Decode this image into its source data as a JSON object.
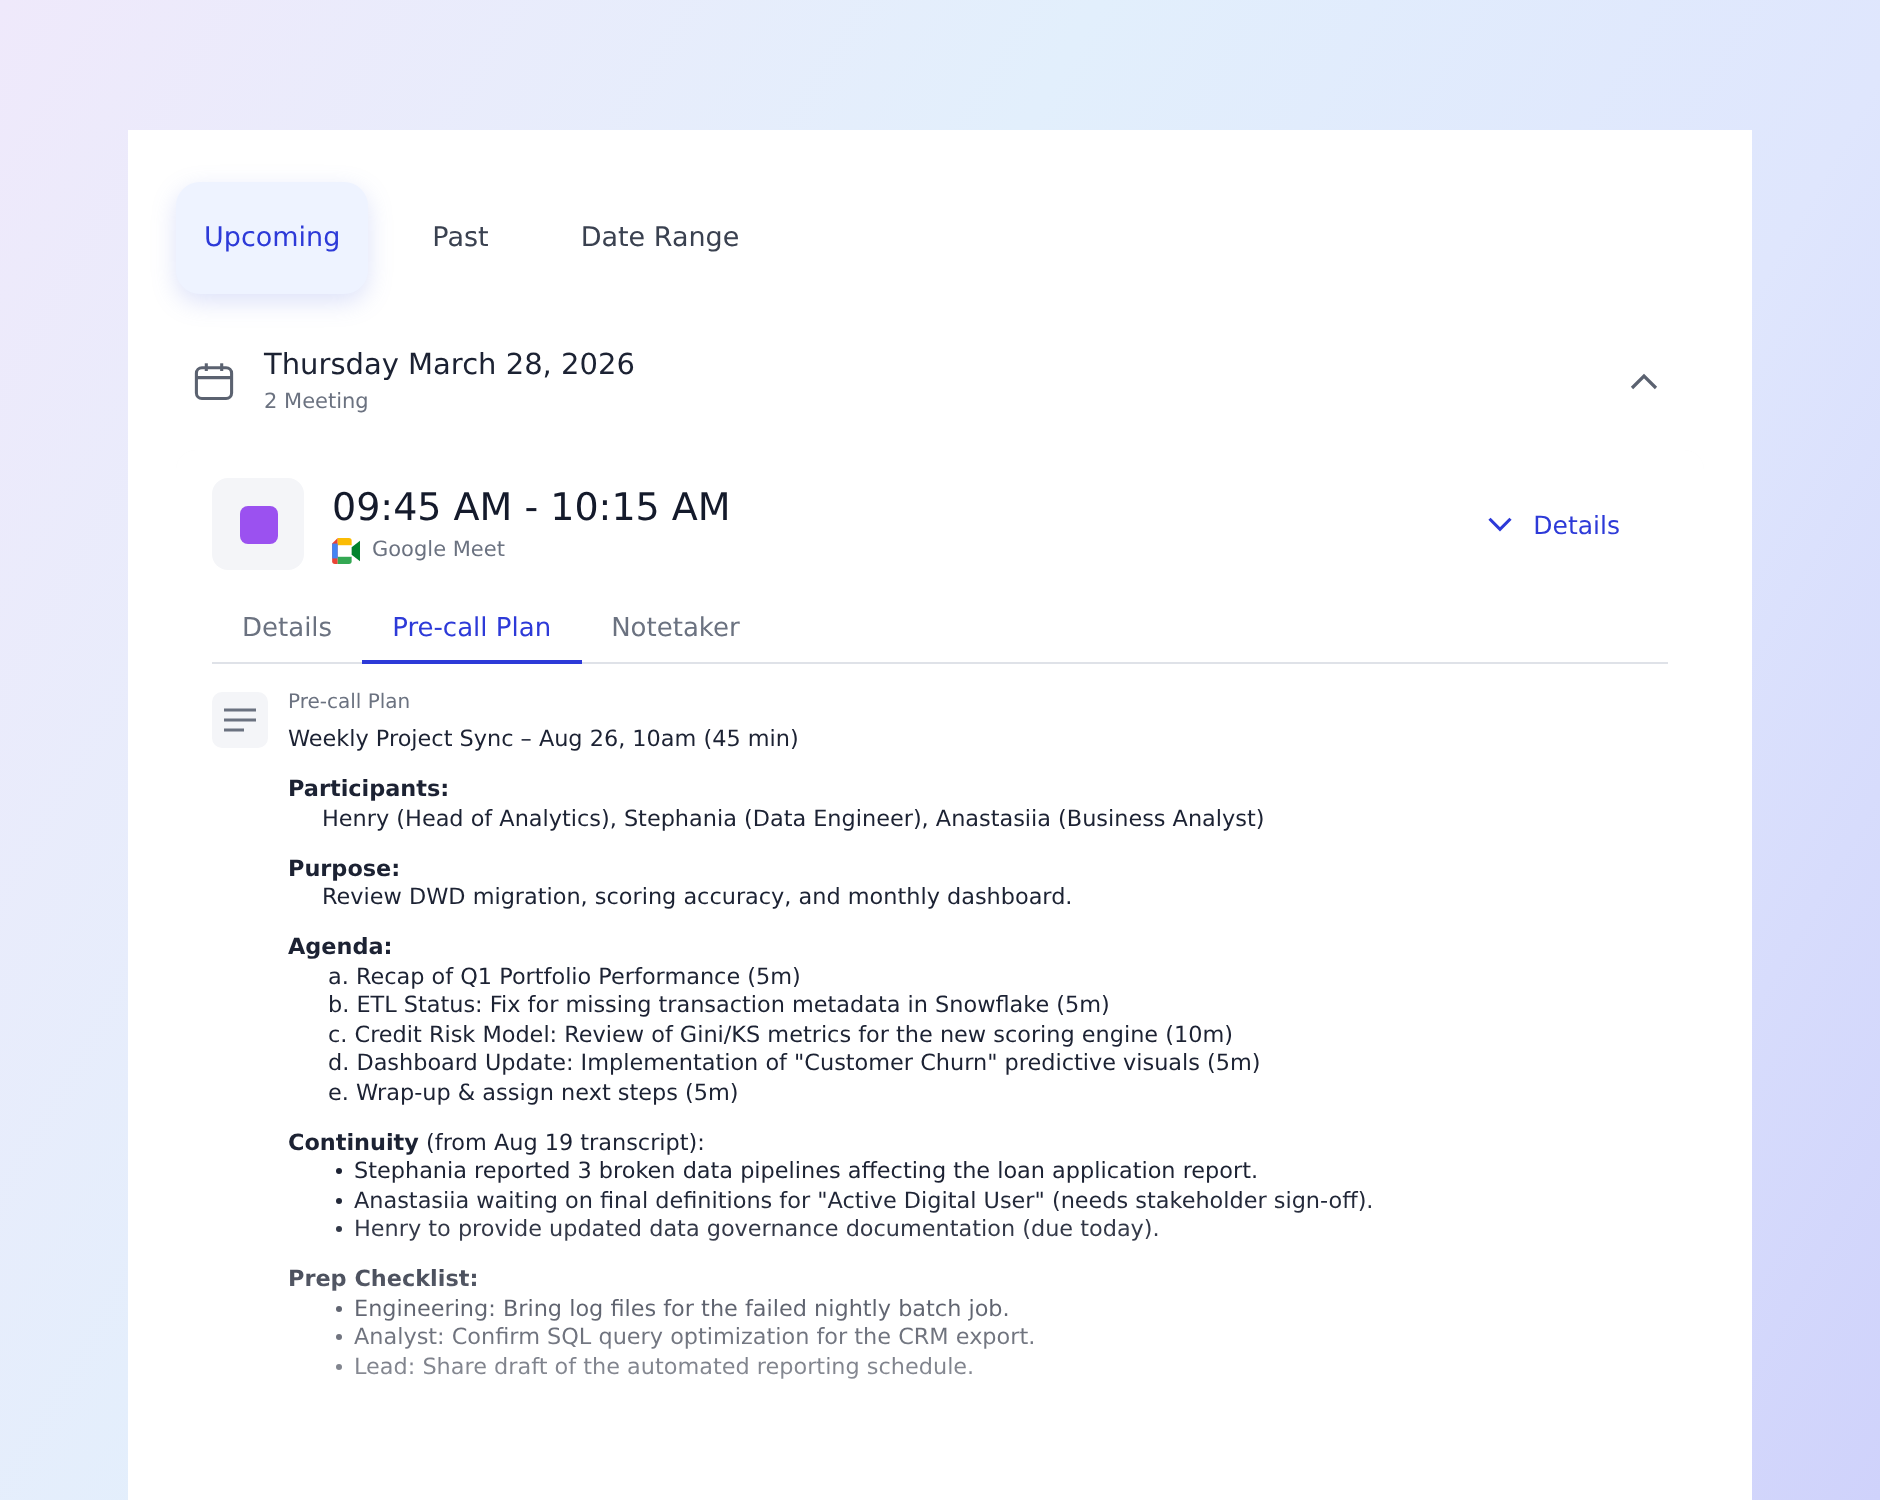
{
  "tabs": [
    {
      "label": "Upcoming",
      "selected": true
    },
    {
      "label": "Past",
      "selected": false
    },
    {
      "label": "Date Range",
      "selected": false
    }
  ],
  "day": {
    "title": "Thursday March 28, 2026",
    "count": "2 Meeting",
    "expanded": true
  },
  "meeting": {
    "color": "#9b51f0",
    "time": "09:45 AM - 10:15 AM",
    "platform": "Google Meet",
    "details_toggle": "Details",
    "expanded": false,
    "tabs": [
      {
        "label": "Details",
        "selected": false
      },
      {
        "label": "Pre-call Plan",
        "selected": true
      },
      {
        "label": "Notetaker",
        "selected": false
      }
    ],
    "plan": {
      "label": "Pre-call Plan",
      "title": "Weekly Project Sync – Aug 26, 10am (45 min)",
      "sections": [
        {
          "heading": "Participants:",
          "kind": "text",
          "items": [
            "Henry (Head of Analytics), Stephania (Data Engineer), Anastasiia (Business Analyst)"
          ]
        },
        {
          "heading": "Purpose:",
          "kind": "text",
          "items": [
            "Review DWD migration, scoring accuracy, and monthly dashboard."
          ]
        },
        {
          "heading": "Agenda:",
          "kind": "list",
          "items": [
            "a. Recap of Q1 Portfolio Performance (5m)",
            "b. ETL Status: Fix for missing transaction metadata in Snowflake (5m)",
            "c. Credit Risk Model: Review of Gini/KS metrics for the new scoring engine (10m)",
            "d. Dashboard Update: Implementation of \"Customer Churn\" predictive visuals (5m)",
            "e. Wrap-up & assign next steps (5m)"
          ]
        },
        {
          "heading": "**Continuity** (from Aug 19 transcript):",
          "kind": "bullets",
          "items": [
            "Stephania reported 3 broken data pipelines affecting the loan application report.",
            "Anastasiia waiting on final definitions for \"Active Digital User\" (needs stakeholder sign-off).",
            "Henry to provide updated data governance documentation (due today)."
          ]
        },
        {
          "heading": "Prep Checklist:",
          "kind": "bullets",
          "items": [
            "Engineering: Bring log files for the failed nightly batch job.",
            "Analyst: Confirm SQL query optimization for the CRM export.",
            "Lead: Share draft of the automated reporting schedule."
          ]
        }
      ]
    }
  }
}
